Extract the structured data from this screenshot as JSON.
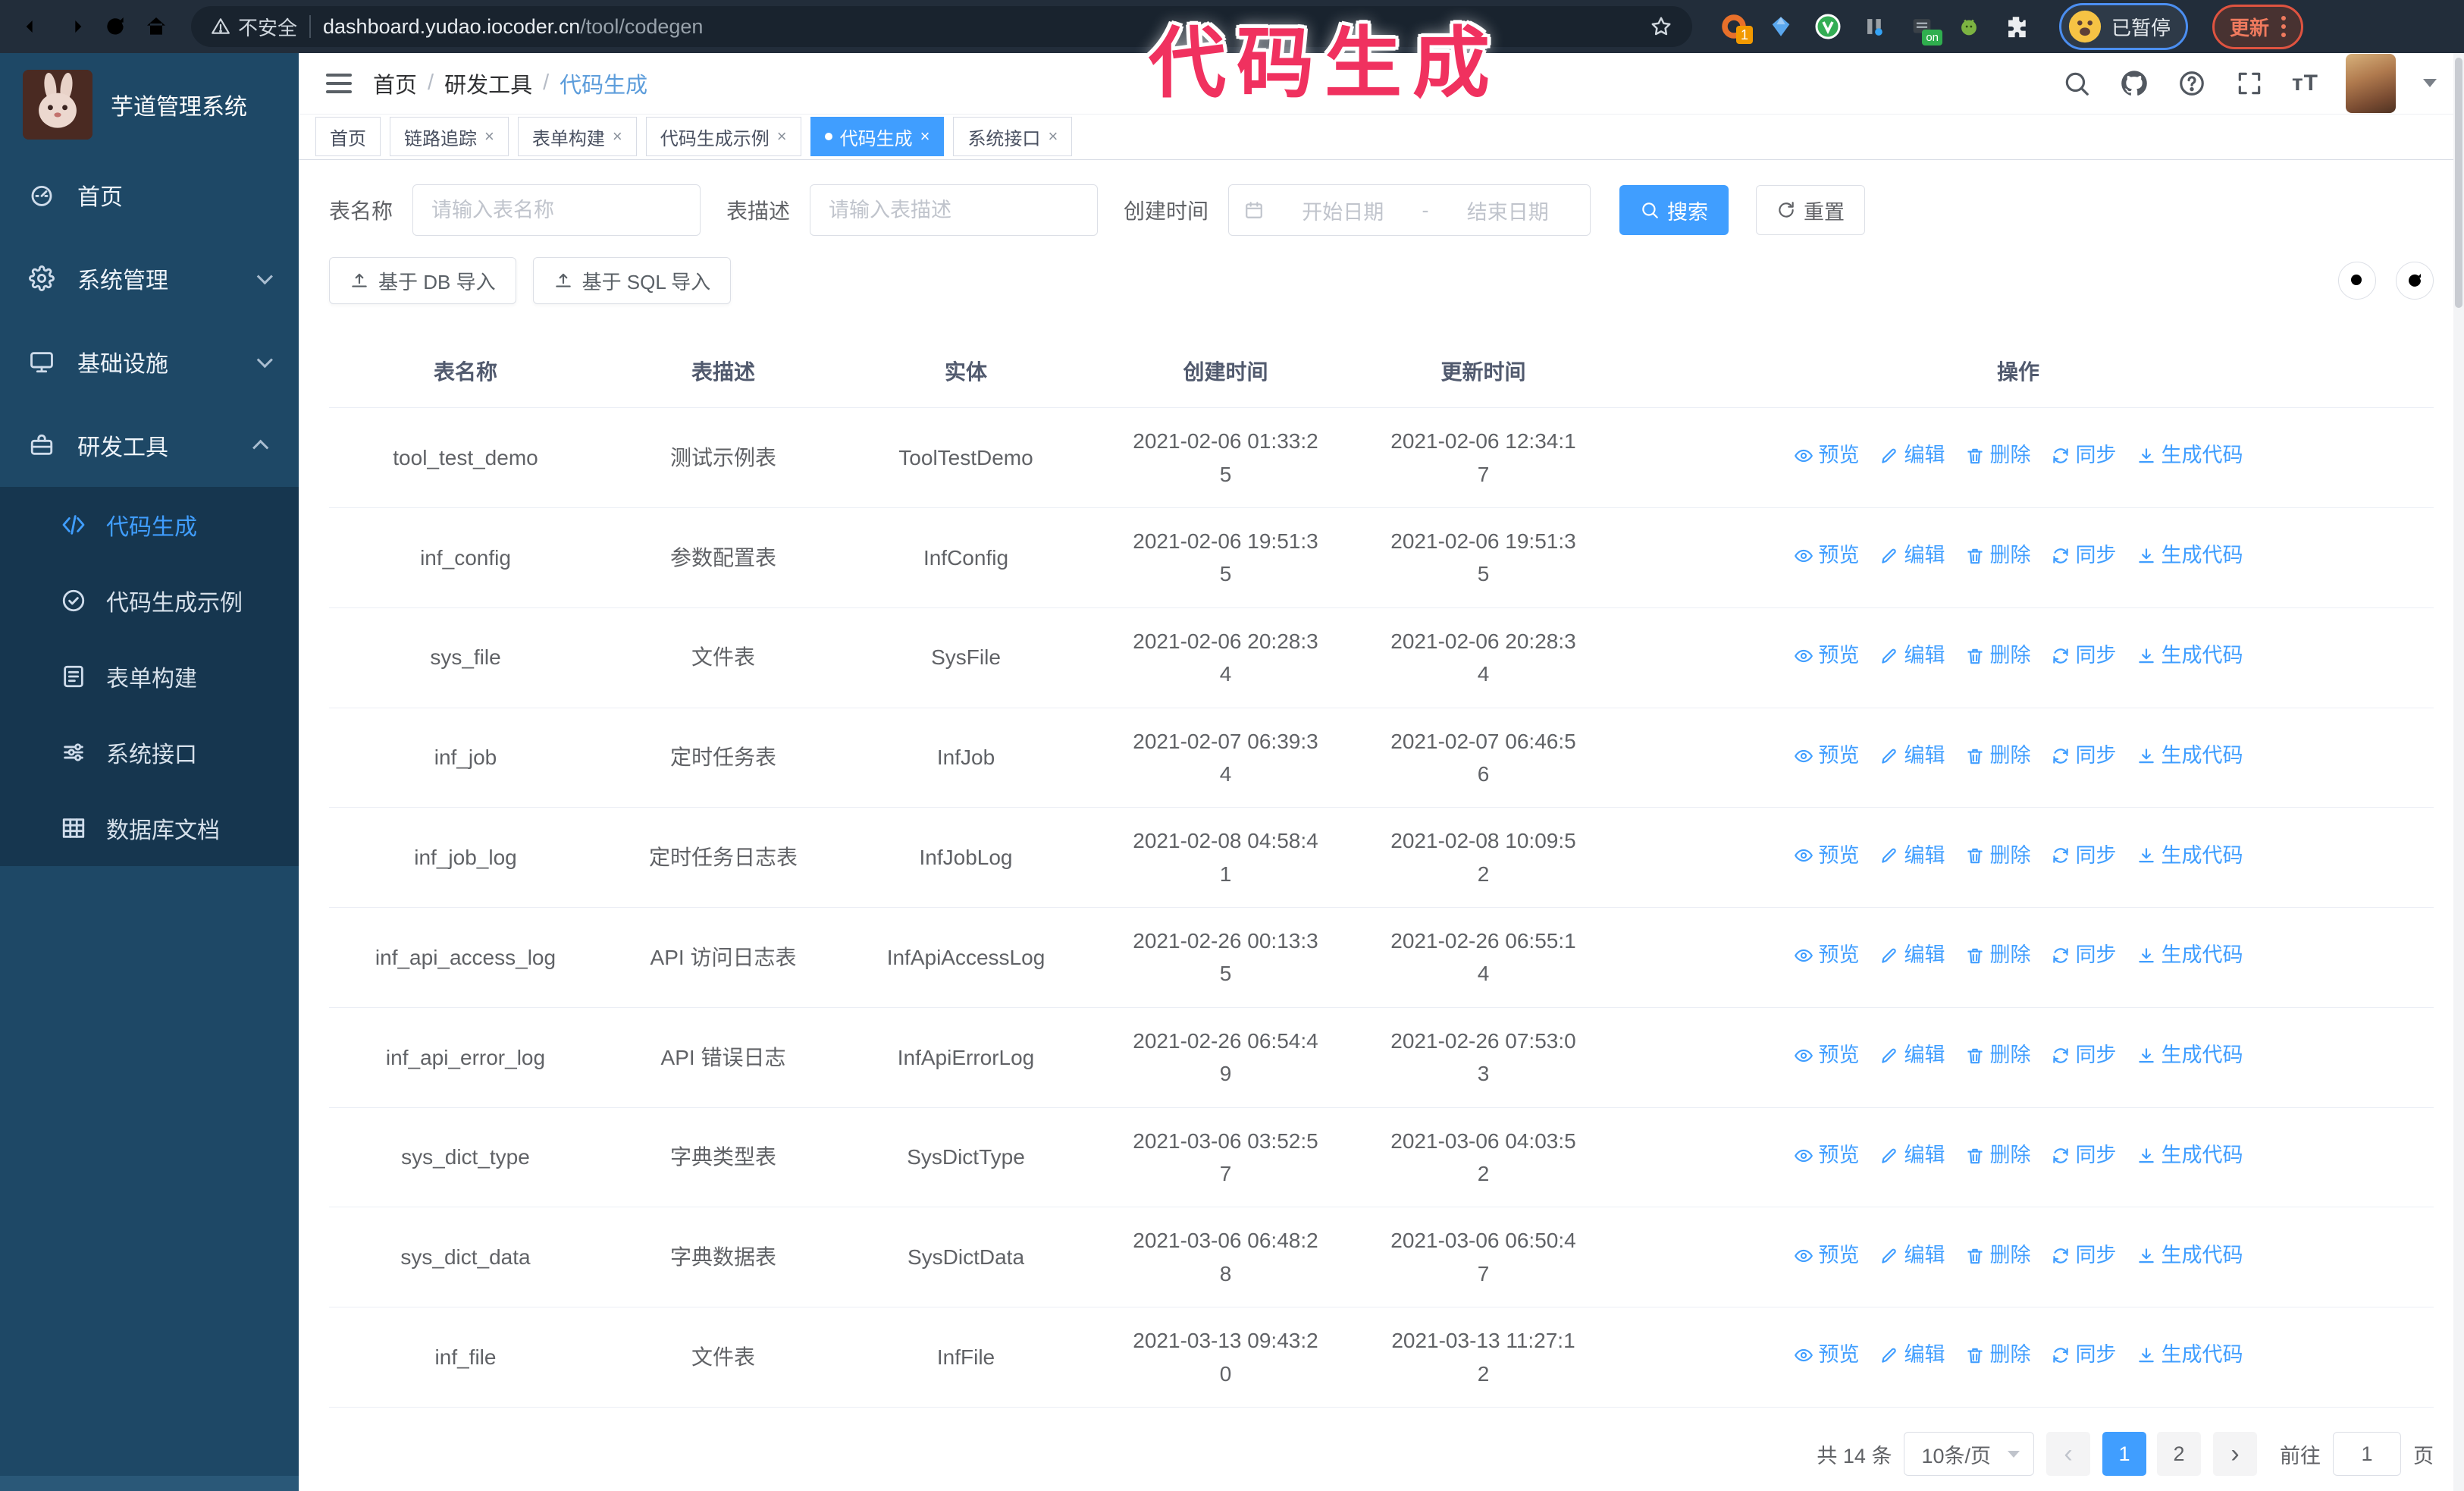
{
  "colors": {
    "accent": "#409eff",
    "sidebar_bg": "#1e4866",
    "sidebar_submenu_bg": "#16364f",
    "annotation": "#f0315f",
    "active_tab_bg": "#409eff"
  },
  "annotation": {
    "text": "代码生成"
  },
  "browser": {
    "security_label": "不安全",
    "url_host": "dashboard.yudao.iocoder.cn",
    "url_path": "/tool/codegen",
    "extension_badge": "1",
    "extension_on_label": "on",
    "paused_label": "已暂停",
    "update_label": "更新"
  },
  "sidebar": {
    "logo_title": "芋道管理系统",
    "menu": [
      {
        "label": "首页",
        "icon": "dashboard-icon",
        "chevron": "",
        "expanded": false
      },
      {
        "label": "系统管理",
        "icon": "gear-icon",
        "chevron": "down",
        "expanded": false
      },
      {
        "label": "基础设施",
        "icon": "monitor-icon",
        "chevron": "down",
        "expanded": false
      },
      {
        "label": "研发工具",
        "icon": "toolbox-icon",
        "chevron": "up",
        "expanded": true
      }
    ],
    "submenu": [
      {
        "label": "代码生成",
        "icon": "code-icon",
        "active": true
      },
      {
        "label": "代码生成示例",
        "icon": "example-icon",
        "active": false
      },
      {
        "label": "表单构建",
        "icon": "form-icon",
        "active": false
      },
      {
        "label": "系统接口",
        "icon": "api-icon",
        "active": false
      },
      {
        "label": "数据库文档",
        "icon": "database-icon",
        "active": false
      }
    ]
  },
  "navbar": {
    "breadcrumb": [
      "首页",
      "研发工具",
      "代码生成"
    ]
  },
  "tabs": [
    {
      "label": "首页",
      "closable": false,
      "active": false
    },
    {
      "label": "链路追踪",
      "closable": true,
      "active": false
    },
    {
      "label": "表单构建",
      "closable": true,
      "active": false
    },
    {
      "label": "代码生成示例",
      "closable": true,
      "active": false
    },
    {
      "label": "代码生成",
      "closable": true,
      "active": true
    },
    {
      "label": "系统接口",
      "closable": true,
      "active": false
    }
  ],
  "search_form": {
    "name_label": "表名称",
    "name_placeholder": "请输入表名称",
    "desc_label": "表描述",
    "desc_placeholder": "请输入表描述",
    "date_label": "创建时间",
    "date_start_placeholder": "开始日期",
    "date_separator": "-",
    "date_end_placeholder": "结束日期",
    "search_label": "搜索",
    "reset_label": "重置"
  },
  "toolbar": {
    "import_db_label": "基于 DB 导入",
    "import_sql_label": "基于 SQL 导入"
  },
  "table": {
    "columns": [
      "表名称",
      "表描述",
      "实体",
      "创建时间",
      "更新时间",
      "操作"
    ],
    "actions": [
      {
        "label": "预览",
        "icon": "eye-icon"
      },
      {
        "label": "编辑",
        "icon": "edit-icon"
      },
      {
        "label": "删除",
        "icon": "delete-icon"
      },
      {
        "label": "同步",
        "icon": "sync-icon"
      },
      {
        "label": "生成代码",
        "icon": "generate-code-icon"
      }
    ],
    "rows": [
      {
        "name": "tool_test_demo",
        "description": "测试示例表",
        "entity": "ToolTestDemo",
        "create_time": "2021-02-06 01:33:25",
        "update_time": "2021-02-06 12:34:17"
      },
      {
        "name": "inf_config",
        "description": "参数配置表",
        "entity": "InfConfig",
        "create_time": "2021-02-06 19:51:35",
        "update_time": "2021-02-06 19:51:35"
      },
      {
        "name": "sys_file",
        "description": "文件表",
        "entity": "SysFile",
        "create_time": "2021-02-06 20:28:34",
        "update_time": "2021-02-06 20:28:34"
      },
      {
        "name": "inf_job",
        "description": "定时任务表",
        "entity": "InfJob",
        "create_time": "2021-02-07 06:39:34",
        "update_time": "2021-02-07 06:46:56"
      },
      {
        "name": "inf_job_log",
        "description": "定时任务日志表",
        "entity": "InfJobLog",
        "create_time": "2021-02-08 04:58:41",
        "update_time": "2021-02-08 10:09:52"
      },
      {
        "name": "inf_api_access_log",
        "description": "API 访问日志表",
        "entity": "InfApiAccessLog",
        "create_time": "2021-02-26 00:13:35",
        "update_time": "2021-02-26 06:55:14"
      },
      {
        "name": "inf_api_error_log",
        "description": "API 错误日志",
        "entity": "InfApiErrorLog",
        "create_time": "2021-02-26 06:54:49",
        "update_time": "2021-02-26 07:53:03"
      },
      {
        "name": "sys_dict_type",
        "description": "字典类型表",
        "entity": "SysDictType",
        "create_time": "2021-03-06 03:52:57",
        "update_time": "2021-03-06 04:03:52"
      },
      {
        "name": "sys_dict_data",
        "description": "字典数据表",
        "entity": "SysDictData",
        "create_time": "2021-03-06 06:48:28",
        "update_time": "2021-03-06 06:50:47"
      },
      {
        "name": "inf_file",
        "description": "文件表",
        "entity": "InfFile",
        "create_time": "2021-03-13 09:43:20",
        "update_time": "2021-03-13 11:27:12"
      }
    ]
  },
  "pagination": {
    "total": "共 14 条",
    "page_size": "10条/页",
    "pages": [
      "1",
      "2"
    ],
    "active_page": "1",
    "goto_label": "前往",
    "goto_value": "1",
    "goto_suffix": "页"
  }
}
